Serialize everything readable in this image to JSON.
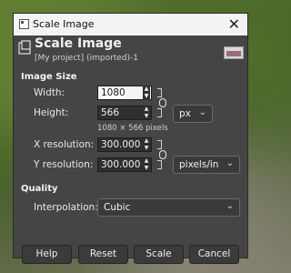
{
  "window": {
    "title": "Scale Image"
  },
  "header": {
    "heading": "Scale Image",
    "subheading": "[My project] (imported)-1"
  },
  "image_size": {
    "section_title": "Image Size",
    "width_label": "Width:",
    "width_value": "1080",
    "height_label": "Height:",
    "height_value": "566",
    "size_info": "1080 × 566 pixels",
    "size_unit": "px",
    "xres_label": "X resolution:",
    "xres_value": "300.000",
    "yres_label": "Y resolution:",
    "yres_value": "300.000",
    "res_unit": "pixels/in"
  },
  "quality": {
    "section_title": "Quality",
    "interpolation_label": "Interpolation:",
    "interpolation_value": "Cubic"
  },
  "buttons": {
    "help": "Help",
    "reset": "Reset",
    "scale": "Scale",
    "cancel": "Cancel"
  },
  "icons": {
    "close": "close-icon",
    "chain": "chain-link-icon",
    "chevron": "chevron-down-icon"
  },
  "colors": {
    "dialog_bg": "#454545",
    "titlebar_bg": "#f3f3f3"
  }
}
